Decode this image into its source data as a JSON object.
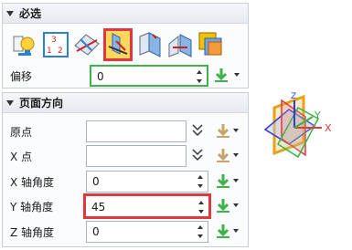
{
  "section1": {
    "title": "必选"
  },
  "tools": [
    {
      "icon": "bulb-face-icon",
      "selected": false
    },
    {
      "icon": "three-point-icon",
      "selected": false
    },
    {
      "icon": "plane-line-icon",
      "selected": false
    },
    {
      "icon": "perpendicular-plane-icon",
      "selected": true
    },
    {
      "icon": "angle-plane-icon",
      "selected": false
    },
    {
      "icon": "mid-plane-icon",
      "selected": false
    },
    {
      "icon": "offset-faces-icon",
      "selected": false
    }
  ],
  "offset": {
    "label": "偏移",
    "value": "0"
  },
  "section2": {
    "title": "页面方向"
  },
  "fields": {
    "origin": {
      "label": "原点",
      "value": ""
    },
    "xpoint": {
      "label": "X 点",
      "value": ""
    },
    "xangle": {
      "label": "X 轴角度",
      "value": "0"
    },
    "yangle": {
      "label": "Y 轴角度",
      "value": "45"
    },
    "zangle": {
      "label": "Z 轴角度",
      "value": "0"
    }
  },
  "preview": {
    "x_label": "X",
    "y_label": "Y",
    "z_label": "Z"
  },
  "colors": {
    "accent_red": "#e0383c",
    "accent_green": "#41b149",
    "highlight": "#ffd75a"
  }
}
